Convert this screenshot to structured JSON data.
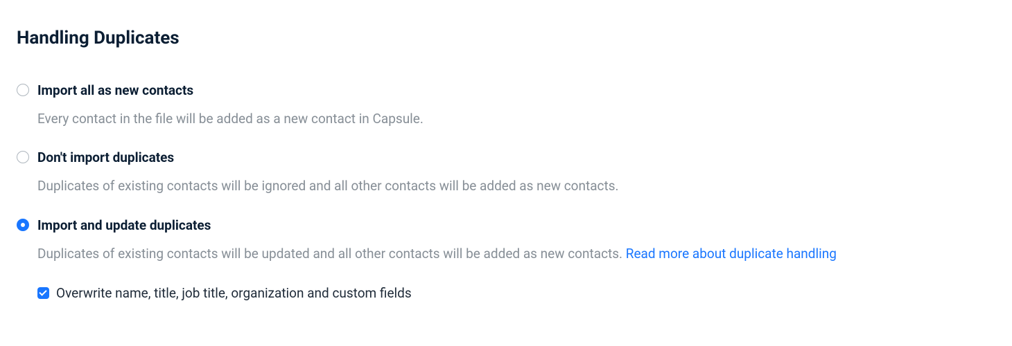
{
  "heading": "Handling Duplicates",
  "options": [
    {
      "label": "Import all as new contacts",
      "desc": "Every contact in the file will be added as a new contact in Capsule.",
      "selected": false
    },
    {
      "label": "Don't import duplicates",
      "desc": "Duplicates of existing contacts will be ignored and all other contacts will be added as new contacts.",
      "selected": false
    },
    {
      "label": "Import and update duplicates",
      "desc": "Duplicates of existing contacts will be updated and all other contacts will be added as new contacts. ",
      "selected": true,
      "link": "Read more about duplicate handling"
    }
  ],
  "checkbox": {
    "label": "Overwrite name, title, job title, organization and custom fields",
    "checked": true
  }
}
